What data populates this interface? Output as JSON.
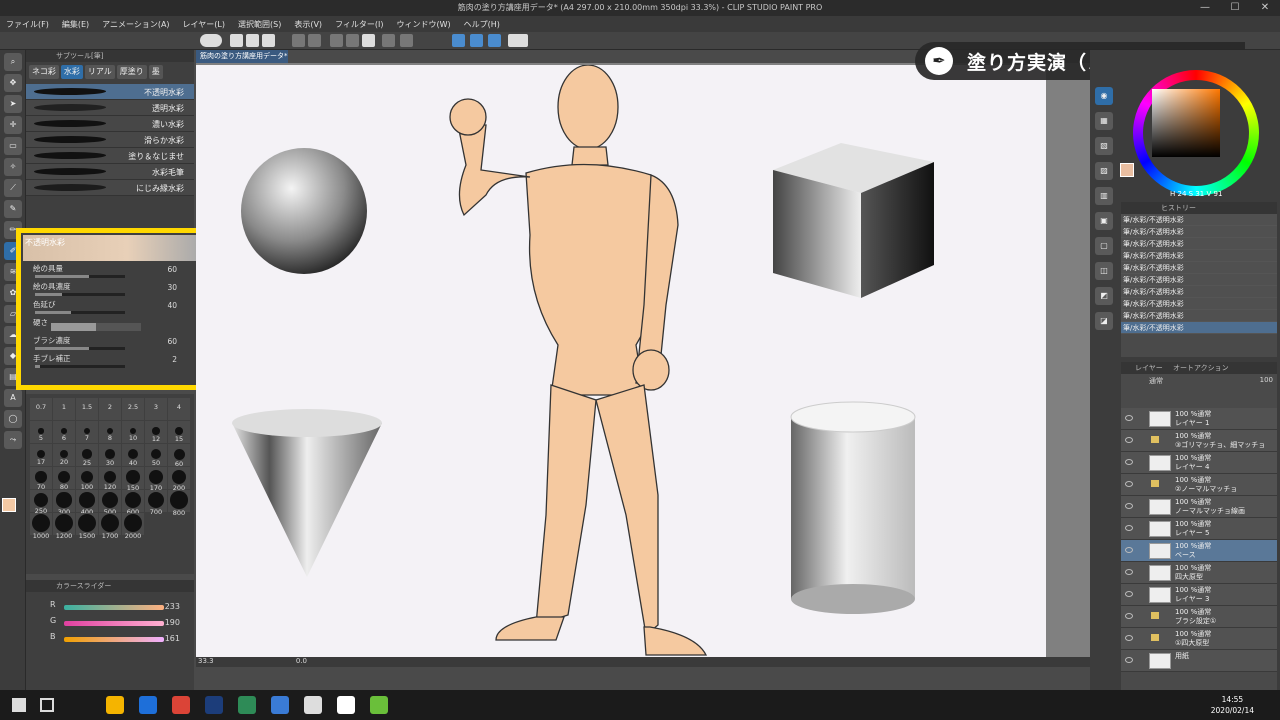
{
  "title_bar": {
    "title": "筋肉の塗り方講座用データ* (A4 297.00 x 210.00mm 350dpi 33.3%) - CLIP STUDIO PAINT PRO",
    "minimize": "—",
    "maximize": "☐",
    "close": "✕"
  },
  "menu": [
    "ファイル(F)",
    "編集(E)",
    "アニメーション(A)",
    "レイヤー(L)",
    "選択範囲(S)",
    "表示(V)",
    "フィルター(I)",
    "ウィンドウ(W)",
    "ヘルプ(H)"
  ],
  "canvas": {
    "tab": "筋肉の塗り方講座用データ*",
    "zoom": "33.3",
    "status_value": "0.0"
  },
  "banner": {
    "text": "塗り方実演（ノーマル）",
    "icon": "pen-nib-icon"
  },
  "subtool": {
    "header": "サブツール[筆]",
    "tabs": [
      "ネコ彩",
      "水彩",
      "リアル",
      "厚塗り",
      "墨"
    ],
    "brushes": [
      "不透明水彩",
      "透明水彩",
      "濃い水彩",
      "滑らか水彩",
      "塗り＆なじませ",
      "水彩毛筆",
      "にじみ縁水彩"
    ]
  },
  "tool_property": {
    "brush_name": "不透明水彩",
    "rows": [
      {
        "label": "絵の具量",
        "value": "60",
        "fill": 0.6
      },
      {
        "label": "絵の具濃度",
        "value": "30",
        "fill": 0.3
      },
      {
        "label": "色延び",
        "value": "40",
        "fill": 0.4
      },
      {
        "label": "硬さ",
        "value": "",
        "fill": 0.5
      },
      {
        "label": "ブラシ濃度",
        "value": "60",
        "fill": 0.6
      },
      {
        "label": "手ブレ補正",
        "value": "2",
        "fill": 0.05
      }
    ]
  },
  "brush_sizes": [
    "0.7",
    "1",
    "1.5",
    "2",
    "2.5",
    "3",
    "4",
    "5",
    "6",
    "7",
    "8",
    "10",
    "12",
    "15",
    "17",
    "20",
    "25",
    "30",
    "40",
    "50",
    "60",
    "70",
    "80",
    "100",
    "120",
    "150",
    "170",
    "200",
    "250",
    "300",
    "400",
    "500",
    "600",
    "700",
    "800",
    "1000",
    "1200",
    "1500",
    "1700",
    "2000"
  ],
  "color_slider": {
    "header": "カラースライダー",
    "rows": [
      {
        "label": "R",
        "value": "233",
        "color": "#ffb080"
      },
      {
        "label": "G",
        "value": "190",
        "color": "#ff70c0"
      },
      {
        "label": "B",
        "value": "161",
        "color": "#ffc000"
      }
    ]
  },
  "color_wheel": {
    "h": "24",
    "s": "31",
    "v": "91",
    "current": "#e9bea1"
  },
  "history": {
    "tab": "ヒストリー",
    "items": [
      "筆/水彩/不透明水彩",
      "筆/水彩/不透明水彩",
      "筆/水彩/不透明水彩",
      "筆/水彩/不透明水彩",
      "筆/水彩/不透明水彩",
      "筆/水彩/不透明水彩",
      "筆/水彩/不透明水彩",
      "筆/水彩/不透明水彩",
      "筆/水彩/不透明水彩",
      "筆/水彩/不透明水彩"
    ]
  },
  "layers": {
    "tabs": [
      "レイヤー",
      "オートアクション"
    ],
    "blend_mode": "通常",
    "opacity": "100",
    "items": [
      {
        "line1": "100 %通常",
        "line2": "レイヤー 1",
        "folder": false
      },
      {
        "line1": "100 %通常",
        "line2": "③ゴリマッチョ、細マッチョ",
        "folder": true
      },
      {
        "line1": "100 %通常",
        "line2": "レイヤー 4",
        "folder": false
      },
      {
        "line1": "100 %通常",
        "line2": "②ノーマルマッチョ",
        "folder": true
      },
      {
        "line1": "100 %通常",
        "line2": "ノーマルマッチョ線画",
        "folder": false
      },
      {
        "line1": "100 %通常",
        "line2": "レイヤー 5",
        "folder": false
      },
      {
        "line1": "100 %通常",
        "line2": "ベース",
        "folder": false,
        "selected": true
      },
      {
        "line1": "100 %通常",
        "line2": "四大原型",
        "folder": false
      },
      {
        "line1": "100 %通常",
        "line2": "レイヤー 3",
        "folder": false
      },
      {
        "line1": "100 %通常",
        "line2": "ブラシ設定①",
        "folder": true
      },
      {
        "line1": "100 %通常",
        "line2": "①四大原型",
        "folder": true
      },
      {
        "line1": "",
        "line2": "用紙",
        "folder": false
      }
    ]
  },
  "taskbar": {
    "time": "14:55",
    "date": "2020/02/14",
    "apps": [
      {
        "color": "#f5b400"
      },
      {
        "color": "#1e6fd9"
      },
      {
        "color": "#db4437"
      },
      {
        "color": "#1c3d7a"
      },
      {
        "color": "#2e8b57"
      },
      {
        "color": "#3a7bd5"
      },
      {
        "color": "#dddddd"
      },
      {
        "color": "#ffffff"
      },
      {
        "color": "#6abf3a"
      }
    ]
  },
  "colors": {
    "accent": "#2f6ea8",
    "highlight": "#ffd800",
    "skin": "#f5c9a0"
  }
}
